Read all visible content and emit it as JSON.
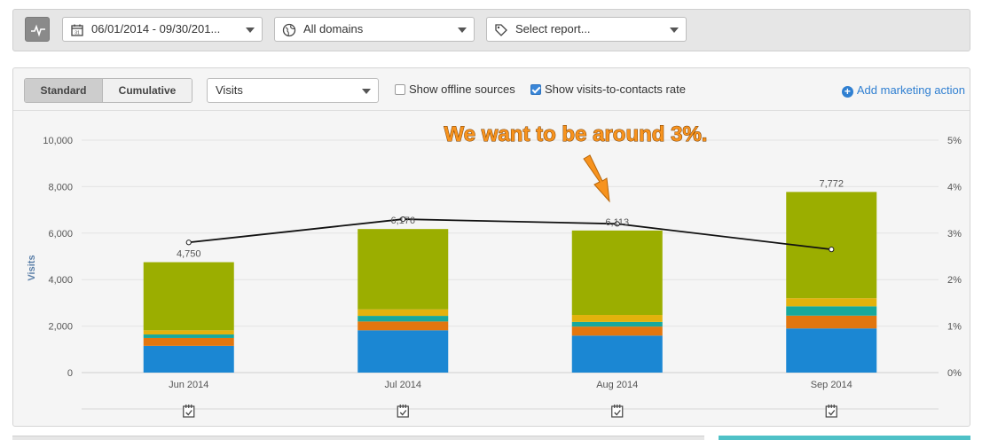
{
  "toolbar": {
    "date_range": "06/01/2014 - 09/30/201...",
    "domain": "All domains",
    "report": "Select report..."
  },
  "controls": {
    "standard_label": "Standard",
    "cumulative_label": "Cumulative",
    "metric": "Visits",
    "offline_label": "Show offline sources",
    "offline_checked": false,
    "rate_label": "Show visits-to-contacts rate",
    "rate_checked": true,
    "add_action_label": "Add marketing action"
  },
  "annotation": {
    "text": "We want to be around 3%."
  },
  "colors": {
    "blue": "#1b87d3",
    "orange": "#e2760f",
    "teal": "#17a89c",
    "gold": "#e3b20c",
    "olive": "#9bae00",
    "accent_link": "#2f7fd1",
    "annotation_fill": "#f7931e"
  },
  "chart_data": {
    "type": "bar",
    "stacked": true,
    "categories": [
      "Jun 2014",
      "Jul 2014",
      "Aug 2014",
      "Sep 2014"
    ],
    "ylabel": "Visits",
    "ylim": [
      0,
      10000
    ],
    "yticks": [
      "0",
      "2,000",
      "4,000",
      "6,000",
      "8,000",
      "10,000"
    ],
    "y2lim": [
      0,
      5
    ],
    "y2ticks": [
      "0%",
      "1%",
      "2%",
      "3%",
      "4%",
      "5%"
    ],
    "totals_labels": [
      "4,750",
      "6,176",
      "6,113",
      "7,772"
    ],
    "series": [
      {
        "color": "#1b87d3",
        "values": [
          1150,
          1820,
          1590,
          1900
        ]
      },
      {
        "color": "#e2760f",
        "values": [
          340,
          380,
          390,
          550
        ]
      },
      {
        "color": "#17a89c",
        "values": [
          150,
          240,
          200,
          400
        ]
      },
      {
        "color": "#e3b20c",
        "values": [
          180,
          280,
          300,
          350
        ]
      },
      {
        "color": "#9bae00",
        "values": [
          2930,
          3456,
          3633,
          4572
        ]
      }
    ],
    "rate": [
      2.8,
      3.3,
      3.2,
      2.65
    ],
    "grid": true
  }
}
